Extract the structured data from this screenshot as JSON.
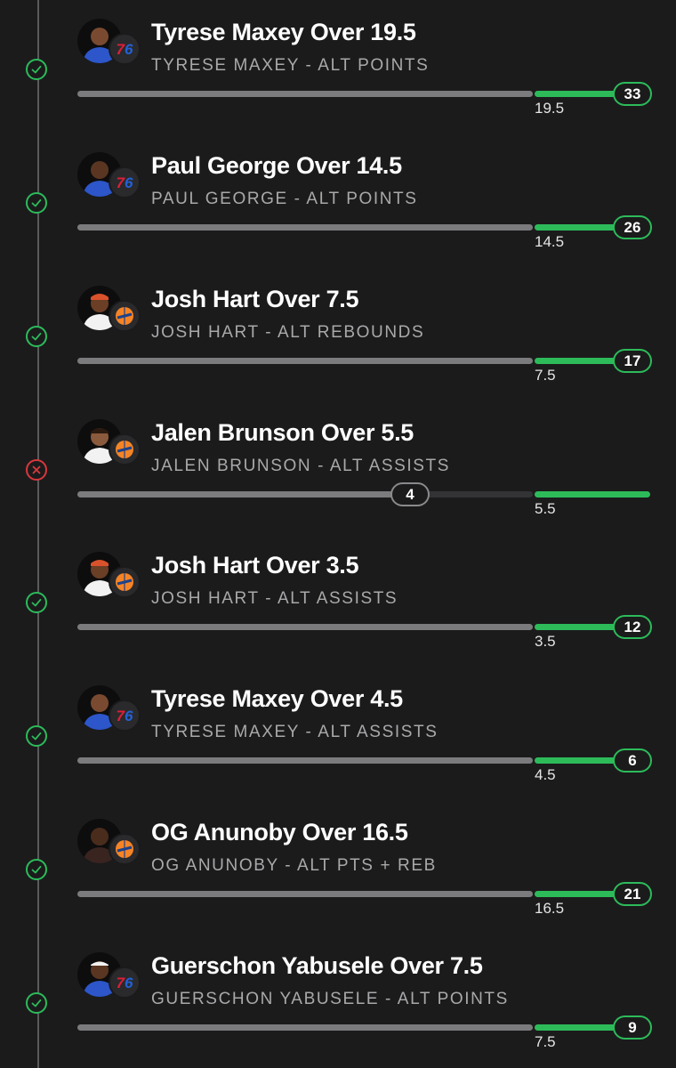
{
  "colors": {
    "background": "#1b1b1c",
    "win_green": "#2dbb5a",
    "loss_red": "#d8383c",
    "track_grey": "#7b7b7d",
    "subtitle_grey": "#a9a9ab"
  },
  "legs": [
    {
      "title": "Tyrese Maxey Over 19.5",
      "subtitle": "TYRESE MAXEY - ALT POINTS",
      "line": "19.5",
      "actual": "33",
      "result": "win",
      "team": "76"
    },
    {
      "title": "Paul George Over 14.5",
      "subtitle": "PAUL GEORGE - ALT POINTS",
      "line": "14.5",
      "actual": "26",
      "result": "win",
      "team": "76"
    },
    {
      "title": "Josh Hart Over 7.5",
      "subtitle": "JOSH HART - ALT REBOUNDS",
      "line": "7.5",
      "actual": "17",
      "result": "win",
      "team": "knicks"
    },
    {
      "title": "Jalen Brunson Over 5.5",
      "subtitle": "JALEN BRUNSON - ALT ASSISTS",
      "line": "5.5",
      "actual": "4",
      "result": "loss",
      "team": "knicks"
    },
    {
      "title": "Josh Hart Over 3.5",
      "subtitle": "JOSH HART - ALT ASSISTS",
      "line": "3.5",
      "actual": "12",
      "result": "win",
      "team": "knicks"
    },
    {
      "title": "Tyrese Maxey Over 4.5",
      "subtitle": "TYRESE MAXEY - ALT ASSISTS",
      "line": "4.5",
      "actual": "6",
      "result": "win",
      "team": "76"
    },
    {
      "title": "OG Anunoby Over 16.5",
      "subtitle": "OG ANUNOBY - ALT PTS + REB",
      "line": "16.5",
      "actual": "21",
      "result": "win",
      "team": "knicks"
    },
    {
      "title": "Guerschon Yabusele Over 7.5",
      "subtitle": "GUERSCHON YABUSELE - ALT POINTS",
      "line": "7.5",
      "actual": "9",
      "result": "win",
      "team": "76"
    }
  ]
}
